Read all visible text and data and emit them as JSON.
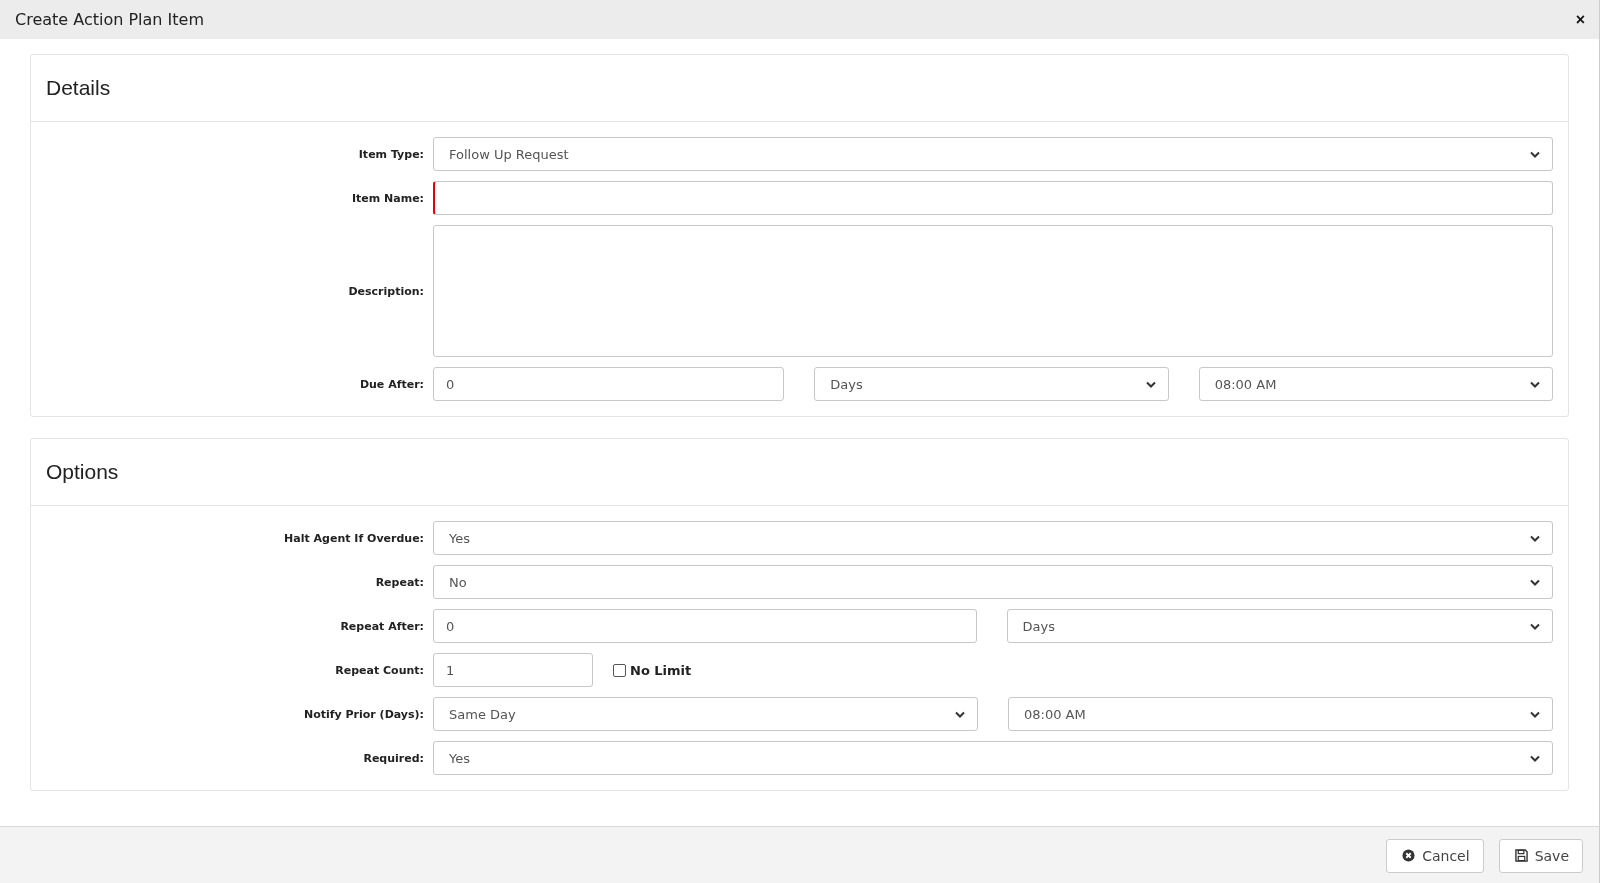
{
  "window": {
    "title": "Create Action Plan Item",
    "close": "×"
  },
  "sections": [
    {
      "title": "Details",
      "rows": [
        {
          "label": "Item Type:",
          "controls": [
            {
              "kind": "select",
              "value": "Follow Up Request"
            }
          ]
        },
        {
          "label": "Item Name:",
          "controls": [
            {
              "kind": "input",
              "invalid": true
            }
          ]
        },
        {
          "label": "Description:",
          "controls": [
            {
              "kind": "textarea"
            }
          ]
        },
        {
          "label": "Due After:",
          "controls": [
            {
              "kind": "input",
              "value": "0",
              "invalid": false
            },
            {
              "kind": "select",
              "value": "Days"
            },
            {
              "kind": "select",
              "value": "08:00 AM"
            }
          ]
        }
      ]
    },
    {
      "title": "Options",
      "rows": [
        {
          "label": "Halt Agent If Overdue:",
          "controls": [
            {
              "kind": "select",
              "value": "Yes"
            }
          ]
        },
        {
          "label": "Repeat:",
          "controls": [
            {
              "kind": "select",
              "value": "No"
            }
          ]
        },
        {
          "label": "Repeat After:",
          "controls": [
            {
              "kind": "input",
              "value": "0",
              "invalid": false
            },
            {
              "kind": "select",
              "value": "Days"
            }
          ]
        },
        {
          "label": "Repeat Count:",
          "controls": [
            {
              "kind": "short-input",
              "value": "1"
            },
            {
              "kind": "checkbox",
              "label": "No Limit",
              "checked": false
            }
          ]
        },
        {
          "label": "Notify Prior (Days):",
          "controls": [
            {
              "kind": "select",
              "value": "Same Day"
            },
            {
              "kind": "select",
              "value": "08:00 AM"
            }
          ]
        },
        {
          "label": "Required:",
          "controls": [
            {
              "kind": "select",
              "value": "Yes"
            }
          ]
        }
      ]
    }
  ],
  "buttons": [
    {
      "kind": "cancel",
      "label": "Cancel"
    },
    {
      "kind": "save",
      "label": "Save"
    }
  ]
}
